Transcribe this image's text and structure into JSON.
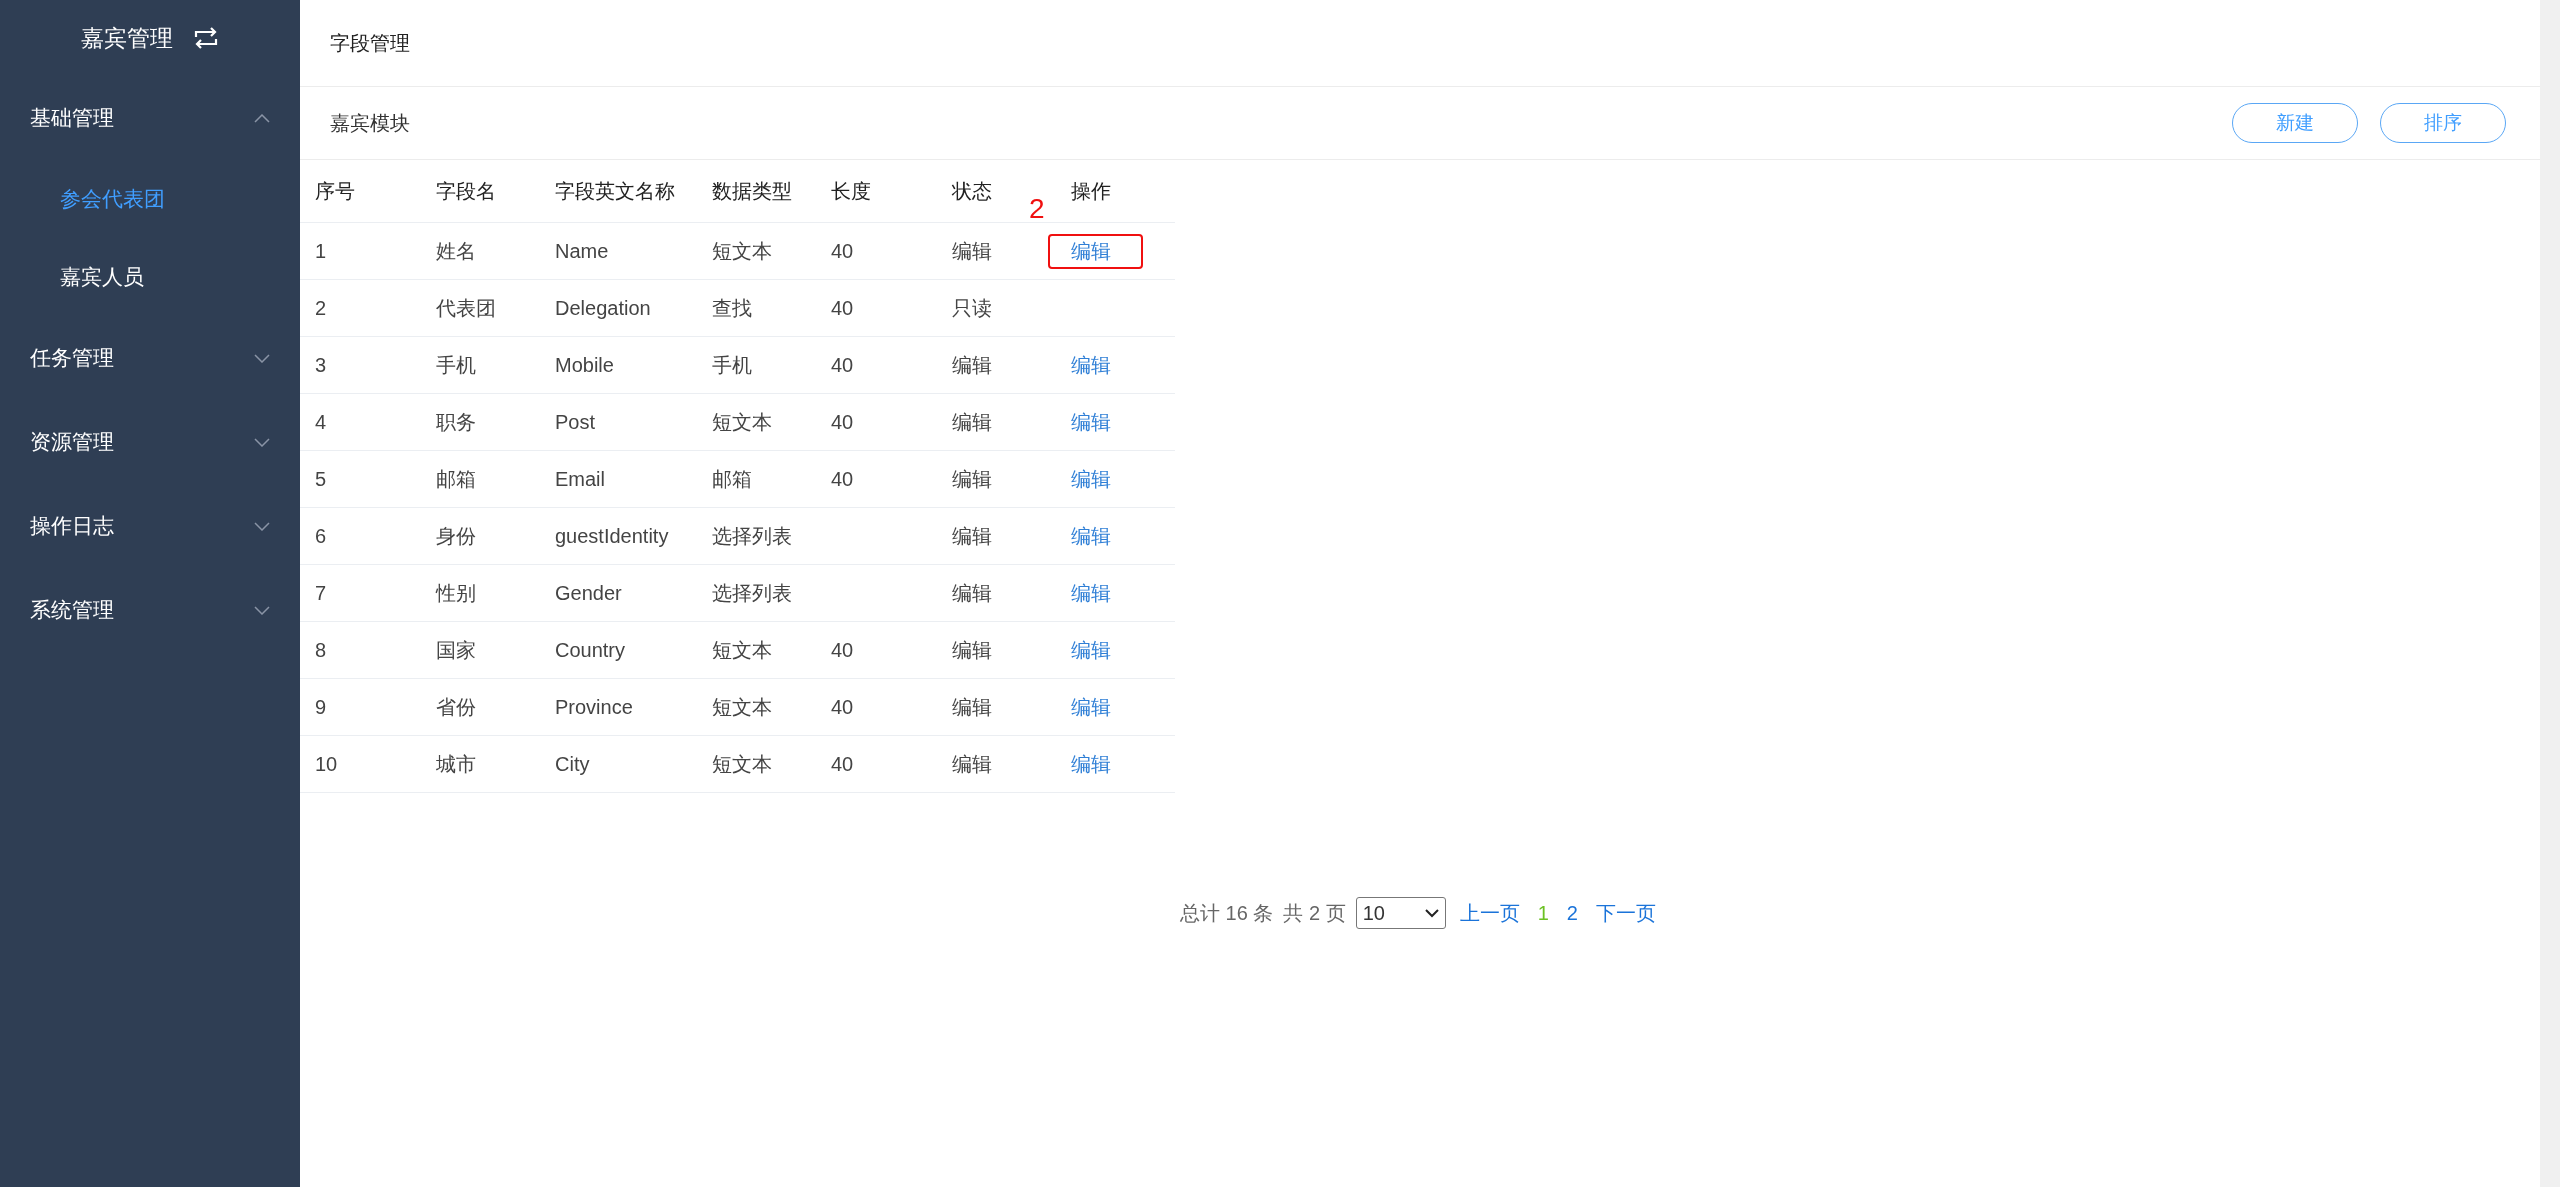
{
  "sidebar": {
    "title": "嘉宾管理",
    "groups": [
      {
        "label": "基础管理",
        "expanded": true,
        "children": [
          {
            "label": "参会代表团",
            "selected": true
          },
          {
            "label": "嘉宾人员",
            "selected": false
          }
        ]
      },
      {
        "label": "任务管理",
        "expanded": false
      },
      {
        "label": "资源管理",
        "expanded": false
      },
      {
        "label": "操作日志",
        "expanded": false
      },
      {
        "label": "系统管理",
        "expanded": false
      }
    ]
  },
  "page_title": "字段管理",
  "section": {
    "title": "嘉宾模块",
    "buttons": [
      "新建",
      "排序"
    ]
  },
  "table": {
    "columns": [
      "序号",
      "字段名",
      "字段英文名称",
      "数据类型",
      "长度",
      "状态",
      "操作"
    ],
    "rows": [
      {
        "no": "1",
        "name": "姓名",
        "en_name": "Name",
        "type": "短文本",
        "length": "40",
        "status": "编辑",
        "action": "编辑",
        "highlighted": true
      },
      {
        "no": "2",
        "name": "代表团",
        "en_name": "Delegation",
        "type": "查找",
        "length": "40",
        "status": "只读",
        "highlighted": false
      },
      {
        "no": "3",
        "name": "手机",
        "en_name": "Mobile",
        "type": "手机",
        "length": "40",
        "status": "编辑",
        "action": "编辑",
        "highlighted": false
      },
      {
        "no": "4",
        "name": "职务",
        "en_name": "Post",
        "type": "短文本",
        "length": "40",
        "status": "编辑",
        "action": "编辑",
        "highlighted": false
      },
      {
        "no": "5",
        "name": "邮箱",
        "en_name": "Email",
        "type": "邮箱",
        "length": "40",
        "status": "编辑",
        "action": "编辑",
        "highlighted": false
      },
      {
        "no": "6",
        "name": "身份",
        "en_name": "guestIdentity",
        "type": "选择列表",
        "status": "编辑",
        "action": "编辑",
        "highlighted": false
      },
      {
        "no": "7",
        "name": "性别",
        "en_name": "Gender",
        "type": "选择列表",
        "status": "编辑",
        "action": "编辑",
        "highlighted": false
      },
      {
        "no": "8",
        "name": "国家",
        "en_name": "Country",
        "type": "短文本",
        "length": "40",
        "status": "编辑",
        "action": "编辑",
        "highlighted": false
      },
      {
        "no": "9",
        "name": "省份",
        "en_name": "Province",
        "type": "短文本",
        "length": "40",
        "status": "编辑",
        "action": "编辑",
        "highlighted": false
      },
      {
        "no": "10",
        "name": "城市",
        "en_name": "City",
        "type": "短文本",
        "length": "40",
        "status": "编辑",
        "action": "编辑",
        "highlighted": false
      }
    ]
  },
  "annotation_label": "2",
  "pager": {
    "total": "总计 16 条",
    "page_count": "共 2 页",
    "page_size": "10",
    "prev": "上一页",
    "pages": [
      {
        "label": "1",
        "selected": true
      },
      {
        "label": "2",
        "selected": false
      }
    ],
    "next": "下一页"
  }
}
